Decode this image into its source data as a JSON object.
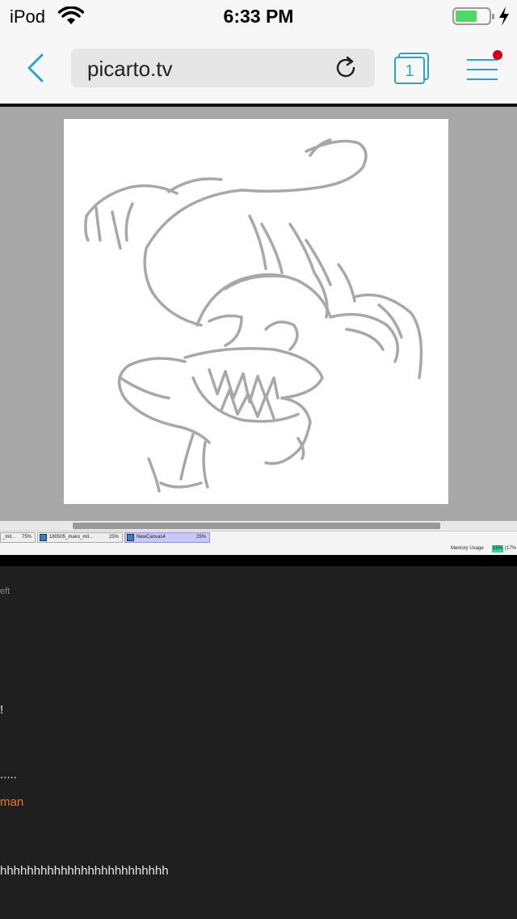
{
  "status_bar": {
    "carrier": "iPod",
    "time": "6:33 PM",
    "battery_level": 0.65
  },
  "browser": {
    "url": "picarto.tv",
    "tab_count": "1",
    "accent_color": "#2aa4c8",
    "notification_dot_color": "#d0021b"
  },
  "stream": {
    "document_tabs": [
      {
        "name": "_mil...",
        "zoom": "75%"
      },
      {
        "name": "180505_mako_mil...",
        "zoom": "25%"
      },
      {
        "name": "NewCanvas4",
        "zoom": "25%"
      }
    ],
    "memory_label": "Memory Usage",
    "memory_value": "15%",
    "memory_extra": "(17%"
  },
  "chat": {
    "lines": [
      {
        "text": "eft"
      },
      {
        "text": "!"
      },
      {
        "text": "....."
      },
      {
        "text": "man"
      },
      {
        "text": "hhhhhhhhhhhhhhhhhhhhhhhhh"
      }
    ]
  }
}
